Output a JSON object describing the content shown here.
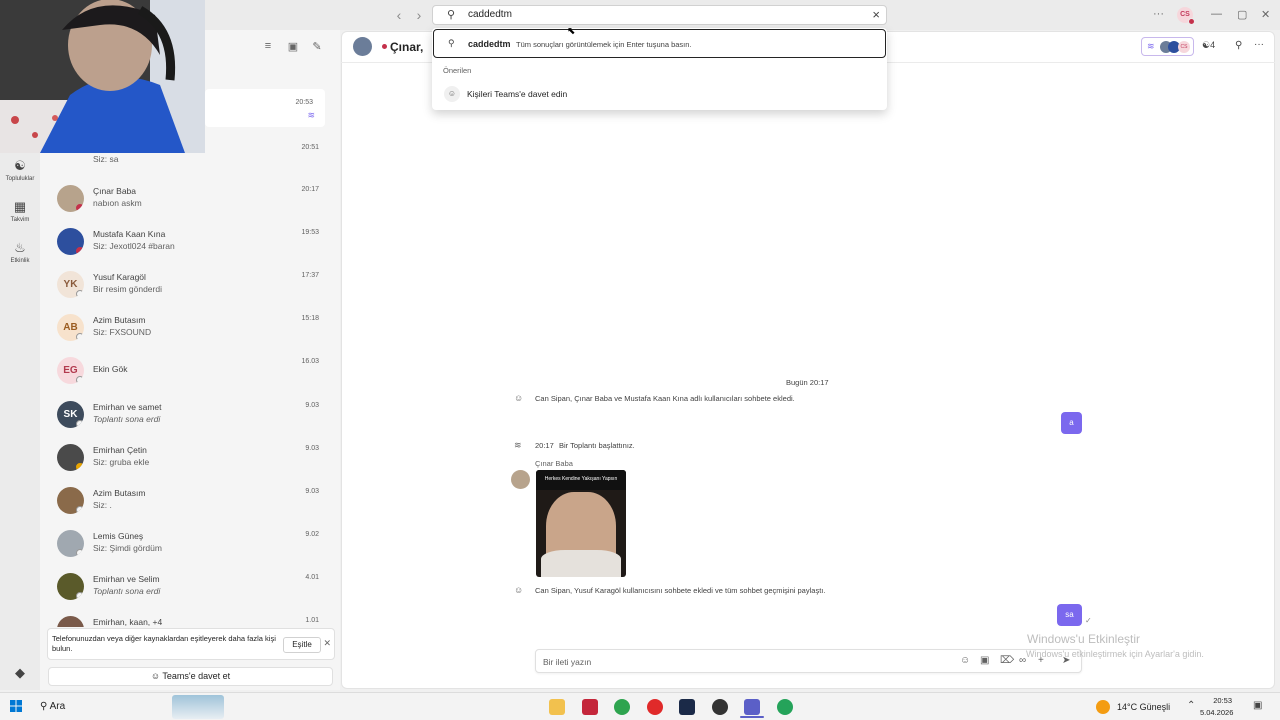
{
  "search": {
    "query": "caddedtm",
    "suggestion_query": "caddedtm",
    "suggestion_hint": "Tüm sonuçları görüntülemek için Enter tuşuna basın.",
    "section_label": "Önerilen",
    "invite_item": "Kişileri Teams'e davet edin"
  },
  "titlebar": {
    "more": "···",
    "user_initials": "CS",
    "minimize": "—",
    "maximize": "▢",
    "close": "✕"
  },
  "rail": [
    {
      "label": "Topluluklar",
      "icon": "people-icon"
    },
    {
      "label": "Takvim",
      "icon": "calendar-icon"
    },
    {
      "label": "Etkinlik",
      "icon": "bell-icon"
    }
  ],
  "chat_list": [
    {
      "name": "",
      "preview": "",
      "time": "20:53",
      "initials": ""
    },
    {
      "name": "",
      "preview": "Siz: sa",
      "time": "20:51",
      "initials": ""
    },
    {
      "name": "Çınar Baba",
      "preview": "nabıon askm",
      "time": "20:17",
      "initials": ""
    },
    {
      "name": "Mustafa Kaan Kına",
      "preview": "Siz: Jexotl024 #baran",
      "time": "19:53",
      "initials": ""
    },
    {
      "name": "Yusuf Karagöl",
      "preview": "Bir resim gönderdi",
      "time": "17:37",
      "initials": "YK"
    },
    {
      "name": "Azim Butasım",
      "preview": "Siz: FXSOUND",
      "time": "15:18",
      "initials": "AB"
    },
    {
      "name": "Ekin Gök",
      "preview": "",
      "time": "16.03",
      "initials": "EG"
    },
    {
      "name": "Emirhan ve samet",
      "preview": "Toplantı sona erdi",
      "time": "9.03",
      "initials": "SK"
    },
    {
      "name": "Emirhan Çetin",
      "preview": "Siz: gruba ekle",
      "time": "9.03",
      "initials": ""
    },
    {
      "name": "Azim Butasım",
      "preview": "Siz: .",
      "time": "9.03",
      "initials": ""
    },
    {
      "name": "Lemis Güneş",
      "preview": "Siz: Şimdi gördüm",
      "time": "9.02",
      "initials": ""
    },
    {
      "name": "Emirhan ve Selim",
      "preview": "Toplantı sona erdi",
      "time": "4.01",
      "initials": ""
    },
    {
      "name": "Emirhan, kaan, +4",
      "preview": "",
      "time": "1.01",
      "initials": ""
    }
  ],
  "notice": {
    "text": "Telefonunuzdan veya diğer kaynaklardan eşitleyerek daha fazla kişi bulun.",
    "button": "Eşitle",
    "close": "✕"
  },
  "invite_button": "Teams'e davet et",
  "chat": {
    "title": "Çınar,",
    "people_count": "4",
    "date_divider": "Bugün 20:17",
    "sys1": "Can Sipan, Çınar Baba ve Mustafa Kaan Kına adlı kullanıcıları sohbete ekledi.",
    "bubble1": "a",
    "meeting_time": "20:17",
    "meeting_text": "Bir Toplantı başlattınız.",
    "sender": "Çınar Baba",
    "image_caption": "Herkes Kendine Yakışanı Yapsın",
    "sys2": "Can Sipan, Yusuf Karagöl kullanıcısını sohbete ekledi ve tüm sohbet geçmişini paylaştı.",
    "bubble2": "sa",
    "compose_placeholder": "Bir ileti yazın"
  },
  "watermark": {
    "title": "Windows'u Etkinleştir",
    "subtitle": "Windows'u etkinleştirmek için Ayarlar'a gidin."
  },
  "taskbar": {
    "search": "Ara",
    "weather": "14°C  Güneşli",
    "time": "20:53",
    "date": "5.04.2026"
  },
  "colors": {
    "accent": "#7b68ee",
    "busy": "#c4314b",
    "teams": "#5b5fc7"
  }
}
